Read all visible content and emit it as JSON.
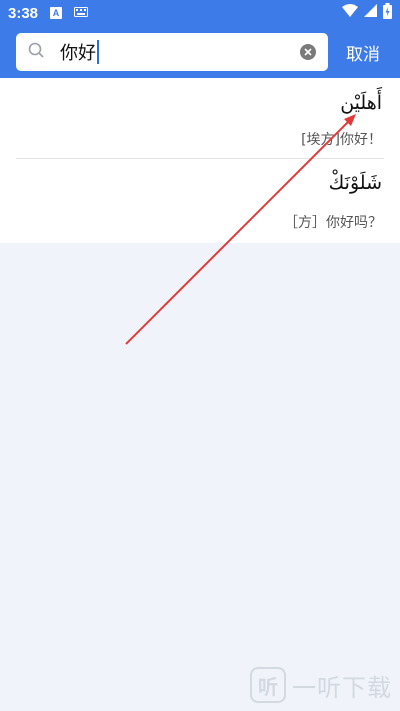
{
  "status_bar": {
    "time": "3:38",
    "app_badge": "A",
    "icons": [
      "keyboard-icon",
      "wifi-icon",
      "signal-icon",
      "battery-icon"
    ]
  },
  "search": {
    "query": "你好",
    "clear_icon": "clear-icon",
    "cancel_label": "取消"
  },
  "results": [
    {
      "arabic": "أَهلَيْن",
      "meaning": "[埃方]你好！"
    },
    {
      "arabic": "شَلَوْنَكْ",
      "meaning": "［方］你好吗？"
    }
  ],
  "watermark": {
    "logo": "听",
    "text": "一听下载"
  },
  "colors": {
    "accent": "#3d7be8",
    "annotation_arrow": "#e03a3a",
    "background": "#f0f4fa"
  }
}
